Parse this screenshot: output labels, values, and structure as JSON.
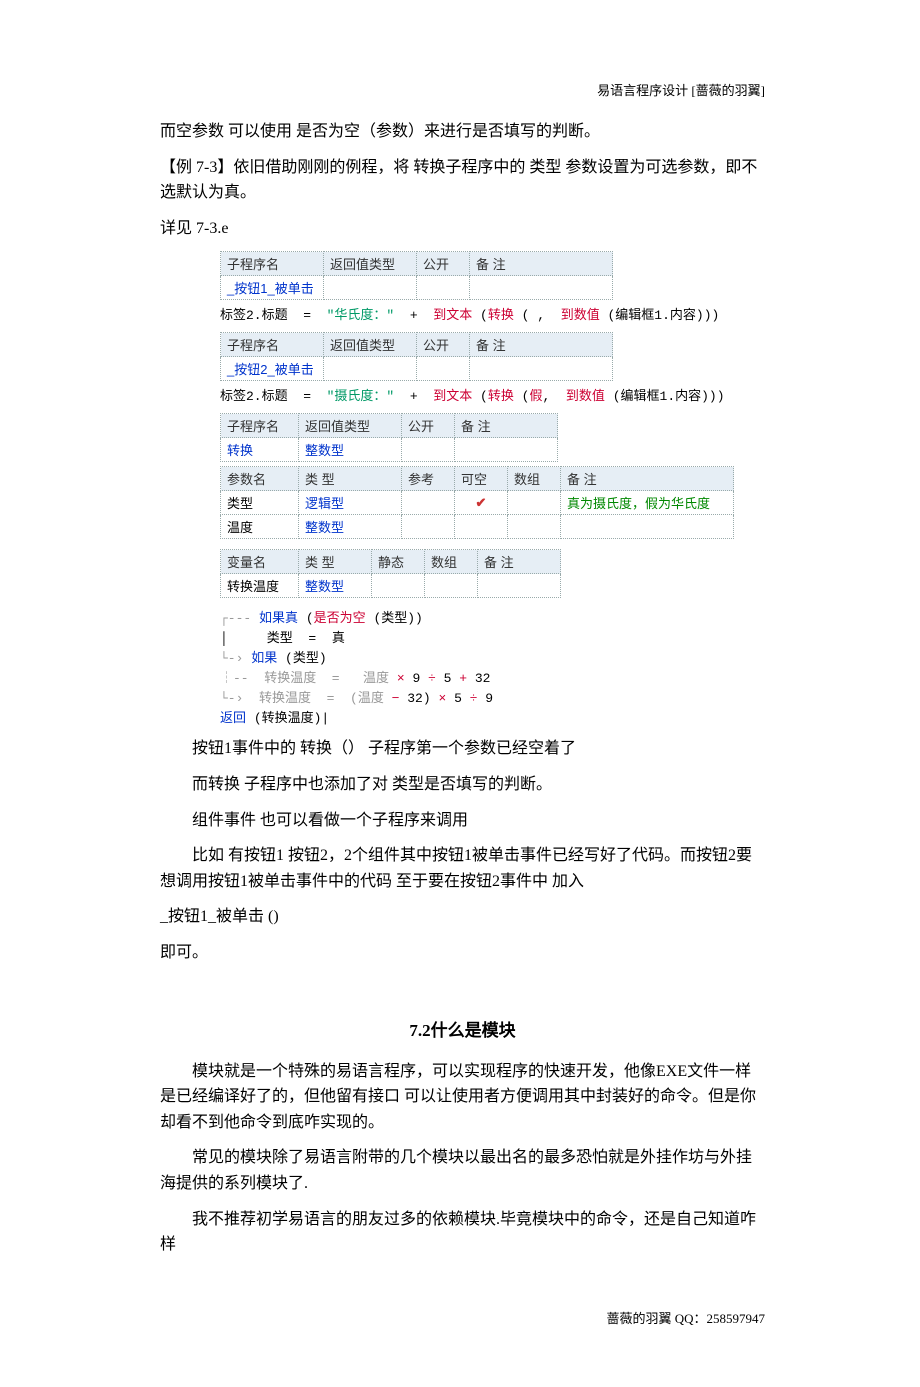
{
  "header": "易语言程序设计 [蔷薇的羽翼]",
  "p1": "而空参数 可以使用 是否为空（参数）来进行是否填写的判断。",
  "p2": "【例 7-3】依旧借助刚刚的例程，将 转换子程序中的 类型 参数设置为可选参数，即不选默认为真。",
  "p3": "详见  7-3.e",
  "tbl1_headers": [
    "子程序名",
    "返回值类型",
    "公开",
    "备  注"
  ],
  "tbl1_row": [
    "_按钮1_被单击",
    "",
    "",
    ""
  ],
  "line1_parts": {
    "a": "标签2.标题  =  ",
    "b": "\"华氏度：\"",
    "c": "  +  ",
    "d": "到文本",
    "e": " (",
    "f": "转换",
    "g": " ( ,  ",
    "h": "到数值",
    "i": " (编辑框1.内容)))"
  },
  "tbl2_headers": [
    "子程序名",
    "返回值类型",
    "公开",
    "备  注"
  ],
  "tbl2_row": [
    "_按钮2_被单击",
    "",
    "",
    ""
  ],
  "line2_parts": {
    "a": "标签2.标题  =  ",
    "b": "\"摄氏度：\"",
    "c": "  +  ",
    "d": "到文本",
    "e": " (",
    "f": "转换",
    "g": " (",
    "h": "假",
    "i": ",  ",
    "j": "到数值",
    "k": " (编辑框1.内容)))"
  },
  "tbl3_headers": [
    "子程序名",
    "返回值类型",
    "公开",
    "备  注"
  ],
  "tbl3_row": [
    "转换",
    "整数型",
    "",
    ""
  ],
  "tbl4_headers": [
    "参数名",
    "类  型",
    "参考",
    "可空",
    "数组",
    "备  注"
  ],
  "tbl4_rows": [
    [
      "类型",
      "逻辑型",
      "",
      "✔",
      "",
      "真为摄氏度，假为华氏度"
    ],
    [
      "温度",
      "整数型",
      "",
      "",
      "",
      ""
    ]
  ],
  "tbl5_headers": [
    "变量名",
    "类  型",
    "静态",
    "数组",
    "备  注"
  ],
  "tbl5_row": [
    "转换温度",
    "整数型",
    "",
    "",
    ""
  ],
  "code_block": {
    "l1_pre": "┌--- ",
    "l1_kw": "如果真",
    "l1_a": " (",
    "l1_fn": "是否为空",
    "l1_b": " (类型))",
    "l2": "│     类型  =  真",
    "l3_pre": "└-› ",
    "l3_kw": "如果",
    "l3_a": " (类型)",
    "l4_pre": "┆--  转换温度  =   温度 ",
    "l4_op1": "×",
    "l4_n1": " 9 ",
    "l4_op2": "÷",
    "l4_n2": " 5 ",
    "l4_op3": "+",
    "l4_n3": " 32",
    "l5_pre": "└-›  转换温度  =  (温度 ",
    "l5_op1": "−",
    "l5_n1": " 32) ",
    "l5_op2": "×",
    "l5_n2": " 5 ",
    "l5_op3": "÷",
    "l5_n3": " 9",
    "l6_kw": "返回",
    "l6_a": " (转换温度)|"
  },
  "p4": "按钮1事件中的 转换（）  子程序第一个参数已经空着了",
  "p5": "而转换 子程序中也添加了对 类型是否填写的判断。",
  "p6": "组件事件 也可以看做一个子程序来调用",
  "p7": "比如 有按钮1 按钮2，2个组件其中按钮1被单击事件已经写好了代码。而按钮2要想调用按钮1被单击事件中的代码 至于要在按钮2事件中 加入",
  "p8": "_按钮1_被单击 ()",
  "p9": "即可。",
  "sec": "7.2什么是模块",
  "p10": "模块就是一个特殊的易语言程序，可以实现程序的快速开发，他像EXE文件一样是已经编译好了的，但他留有接口 可以让使用者方便调用其中封装好的命令。但是你却看不到他命令到底咋实现的。",
  "p11": "常见的模块除了易语言附带的几个模块以最出名的最多恐怕就是外挂作坊与外挂海提供的系列模块了.",
  "p12": "我不推荐初学易语言的朋友过多的依赖模块.毕竟模块中的命令，还是自己知道咋样",
  "footer": "蔷薇的羽翼 QQ：258597947"
}
